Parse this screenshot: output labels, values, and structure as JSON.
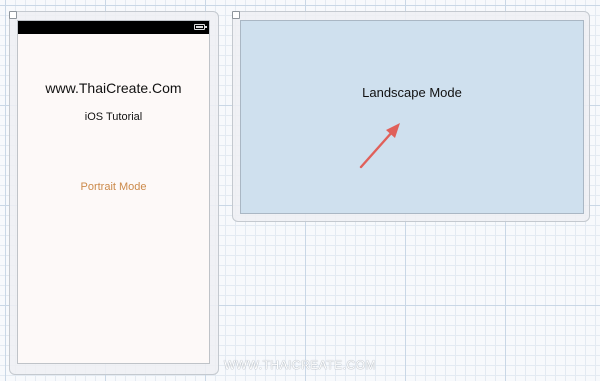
{
  "portrait_scene": {
    "title": "www.ThaiCreate.Com",
    "subtitle": "iOS Tutorial",
    "mode_label": "Portrait Mode",
    "mode_label_color": "#cc8a4a"
  },
  "landscape_scene": {
    "mode_label": "Landscape Mode",
    "background_color": "#cfe0ee"
  },
  "annotation": {
    "arrow_color": "#e0605a",
    "arrow_icon": "arrow-up-right-icon"
  },
  "watermark": "WWW.THAICREATE.COM"
}
